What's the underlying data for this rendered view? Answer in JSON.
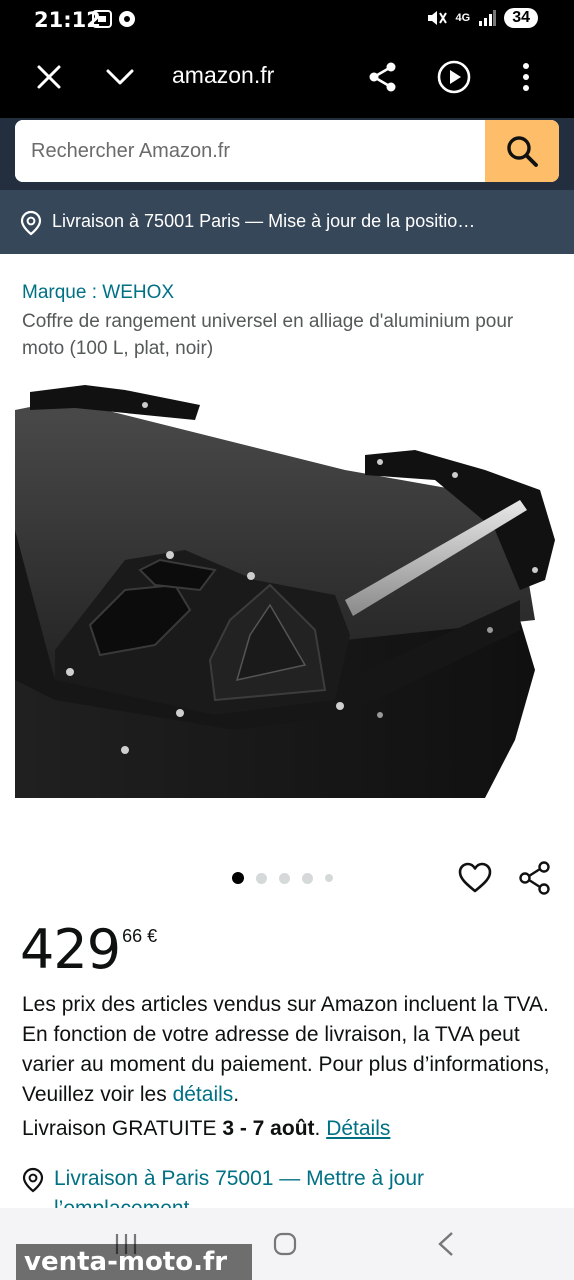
{
  "status_bar": {
    "time": "21:12",
    "battery": "34",
    "network": "4G"
  },
  "browser": {
    "url": "amazon.fr",
    "icons": [
      "close-icon",
      "chevron-down-icon",
      "share-icon",
      "play-icon",
      "more-vertical-icon"
    ]
  },
  "search": {
    "placeholder": "Rechercher Amazon.fr"
  },
  "delivery_bar": {
    "text": "Livraison à 75001 Paris — Mise à jour de la positio…"
  },
  "product": {
    "brand": "Marque : WEHOX",
    "title": "Coffre de rangement universel en alliage d'aluminium pour moto (100 L, plat, noir)",
    "image_count": 5,
    "active_image": 1,
    "price_whole": "429",
    "price_fraction": "66 €"
  },
  "tva": {
    "text": "Les prix des articles vendus sur Amazon incluent la TVA. En fonction de votre adresse de livraison, la TVA peut varier au moment du paiement. Pour plus d’informations, Veuillez voir les ",
    "link": "détails",
    "end": "."
  },
  "shipping": {
    "prefix": "Livraison GRATUITE ",
    "dates": "3 - 7 août",
    "sep": ". ",
    "link": "Détails"
  },
  "location": {
    "line1": "Livraison à Paris 75001 — Mettre à jour",
    "line2": "l’emplacement"
  },
  "watermark": "venta-moto.fr",
  "colors": {
    "header": "#232f3e",
    "delivery_bar": "#37475a",
    "search_button": "#febd69",
    "link": "#007185"
  }
}
